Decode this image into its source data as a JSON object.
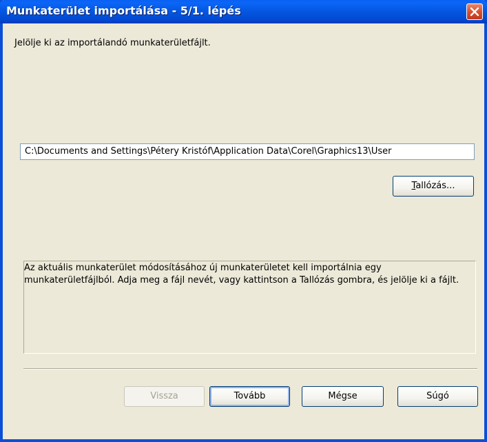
{
  "window": {
    "title": "Munkaterület importálása - 5/1. lépés"
  },
  "instruction": "Jelölje ki az importálandó munkaterületfájlt.",
  "path_field": {
    "value": "C:\\Documents and Settings\\Pétery Kristóf\\Application Data\\Corel\\Graphics13\\User"
  },
  "browse_button": {
    "label_underlined": "T",
    "label_rest": "allózás..."
  },
  "description": "Az aktuális munkaterület módosításához új munkaterületet kell importálnia egy munkaterületfájlból. Adja meg a fájl nevét, vagy kattintson a Tallózás gombra, és jelölje ki a fájlt.",
  "buttons": {
    "back": "Vissza",
    "next": "Tovább",
    "cancel": "Mégse",
    "help": "Súgó"
  },
  "colors": {
    "titlebar": "#0458e2",
    "window_bg": "#ece9d8",
    "close_button": "#d8502e",
    "disabled_text": "#a5a293"
  }
}
